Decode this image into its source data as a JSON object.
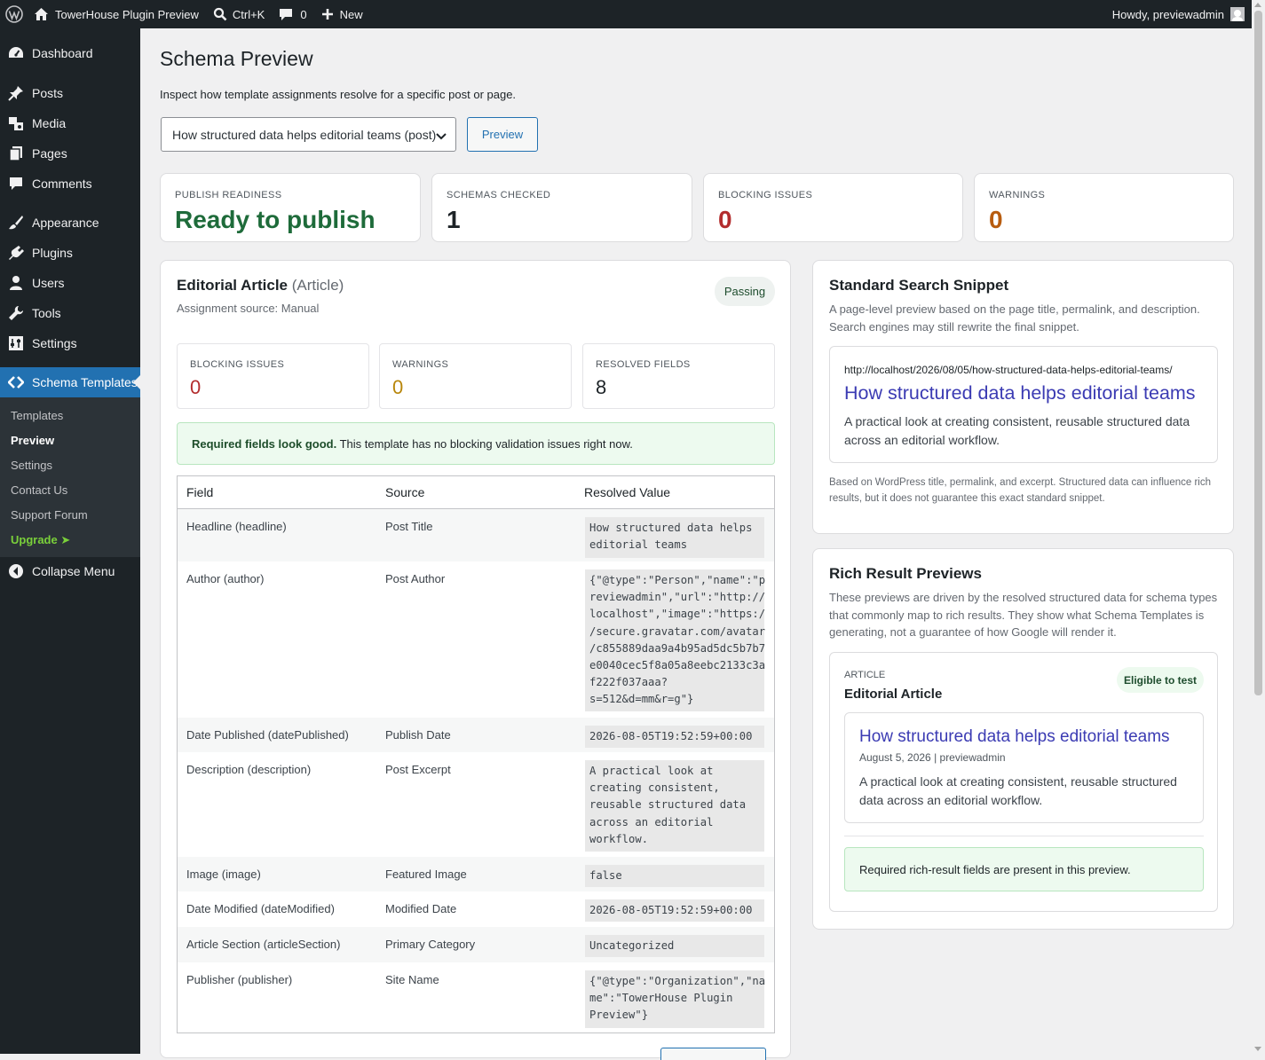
{
  "adminbar": {
    "site_name": "TowerHouse Plugin Preview",
    "search_label": "Ctrl+K",
    "comments_count": "0",
    "new_label": "New",
    "howdy": "Howdy, previewadmin"
  },
  "sidebar": {
    "items": [
      {
        "label": "Dashboard",
        "icon": "dashboard-icon"
      },
      {
        "label": "Posts",
        "icon": "pin-icon"
      },
      {
        "label": "Media",
        "icon": "media-icon"
      },
      {
        "label": "Pages",
        "icon": "pages-icon"
      },
      {
        "label": "Comments",
        "icon": "comments-icon"
      },
      {
        "label": "Appearance",
        "icon": "brush-icon"
      },
      {
        "label": "Plugins",
        "icon": "plugin-icon"
      },
      {
        "label": "Users",
        "icon": "users-icon"
      },
      {
        "label": "Tools",
        "icon": "wrench-icon"
      },
      {
        "label": "Settings",
        "icon": "settings-icon"
      },
      {
        "label": "Schema Templates",
        "icon": "code-icon"
      }
    ],
    "submenu": [
      "Templates",
      "Preview",
      "Settings",
      "Contact Us",
      "Support Forum",
      "Upgrade"
    ],
    "upgrade_arrow": "➤",
    "collapse": "Collapse Menu"
  },
  "page": {
    "title": "Schema Preview",
    "description": "Inspect how template assignments resolve for a specific post or page.",
    "select_value": "How structured data helps editorial teams (post)",
    "preview_button": "Preview"
  },
  "stats": [
    {
      "label": "Publish Readiness",
      "value": "Ready to publish",
      "color": "#1e6b3a"
    },
    {
      "label": "Schemas Checked",
      "value": "1",
      "color": "#1d2327"
    },
    {
      "label": "Blocking Issues",
      "value": "0",
      "color": "#b32d2e"
    },
    {
      "label": "Warnings",
      "value": "0",
      "color": "#b85c0f"
    }
  ],
  "template": {
    "name": "Editorial Article",
    "type": "(Article)",
    "status": "Passing",
    "source": "Assignment source: Manual",
    "mini": [
      {
        "label": "Blocking Issues",
        "value": "0",
        "color": "#b32d2e"
      },
      {
        "label": "Warnings",
        "value": "0",
        "color": "#b8860b"
      },
      {
        "label": "Resolved Fields",
        "value": "8",
        "color": "#1d2327"
      }
    ],
    "notice_bold": "Required fields look good.",
    "notice_text": " This template has no blocking validation issues right now.",
    "table": {
      "headers": [
        "Field",
        "Source",
        "Resolved Value"
      ],
      "rows": [
        {
          "field": "Headline (headline)",
          "source": "Post Title",
          "value": "How structured data helps\neditorial teams"
        },
        {
          "field": "Author (author)",
          "source": "Post Author",
          "value": "{\"@type\":\"Person\",\"name\":\"p\nreviewadmin\",\"url\":\"http://\nlocalhost\",\"image\":\"https:/\n/secure.gravatar.com/avatar\n/c855889daa9a4b95ad5dc5b7b7\ne0040cec5f8a05a8eebc2133c3a\nf222f037aaa?\ns=512&d=mm&r=g\"}"
        },
        {
          "field": "Date Published (datePublished)",
          "source": "Publish Date",
          "value": "2026-08-05T19:52:59+00:00"
        },
        {
          "field": "Description (description)",
          "source": "Post Excerpt",
          "value": "A practical look at\ncreating consistent,\nreusable structured data\nacross an editorial\nworkflow."
        },
        {
          "field": "Image (image)",
          "source": "Featured Image",
          "value": "false"
        },
        {
          "field": "Date Modified (dateModified)",
          "source": "Modified Date",
          "value": "2026-08-05T19:52:59+00:00"
        },
        {
          "field": "Article Section (articleSection)",
          "source": "Primary Category",
          "value": "Uncategorized"
        },
        {
          "field": "Publisher (publisher)",
          "source": "Site Name",
          "value": "{\"@type\":\"Organization\",\"na\nme\":\"TowerHouse Plugin\nPreview\"}"
        }
      ]
    }
  },
  "snippet": {
    "title": "Standard Search Snippet",
    "desc": "A page-level preview based on the page title, permalink, and description. Search engines may still rewrite the final snippet.",
    "url": "http://localhost/2026/08/05/how-structured-data-helps-editorial-teams/",
    "headline": "How structured data helps editorial teams",
    "excerpt": "A practical look at creating consistent, reusable structured data across an editorial workflow.",
    "footnote": "Based on WordPress title, permalink, and excerpt. Structured data can influence rich results, but it does not guarantee this exact standard snippet."
  },
  "rich": {
    "title": "Rich Result Previews",
    "desc": "These previews are driven by the resolved structured data for schema types that commonly map to rich results. They show what Schema Templates is generating, not a guarantee of how Google will render it.",
    "kind": "ARTICLE",
    "name": "Editorial Article",
    "badge": "Eligible to test",
    "headline": "How structured data helps editorial teams",
    "meta": "August 5, 2026 | previewadmin",
    "excerpt": "A practical look at creating consistent, reusable structured data across an editorial workflow.",
    "notice": "Required rich-result fields are present in this preview."
  }
}
